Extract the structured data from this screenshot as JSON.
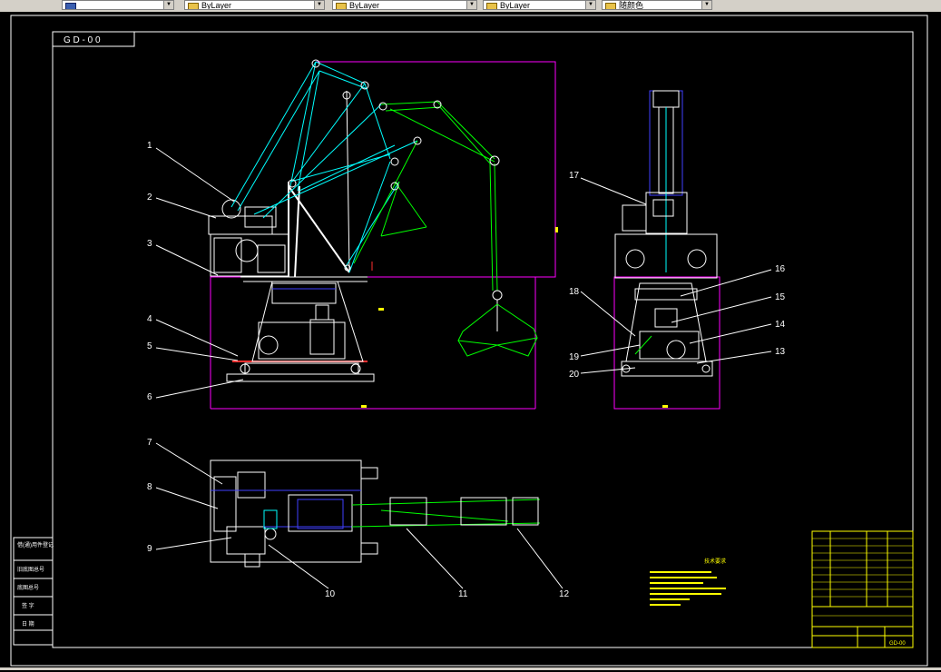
{
  "toolbar": {
    "items": [
      {
        "label": "",
        "swatch": "blue"
      },
      {
        "label": "ByLayer",
        "swatch": "yellow"
      },
      {
        "label": "ByLayer",
        "swatch": "yellow"
      },
      {
        "label": "ByLayer",
        "swatch": "yellow"
      },
      {
        "label": "随颜色",
        "swatch": "yellow"
      }
    ]
  },
  "drawing": {
    "code": "G D - 0 0",
    "callouts_front": [
      "1",
      "2",
      "3",
      "4",
      "5",
      "6"
    ],
    "callouts_side": [
      "17",
      "16",
      "15",
      "14",
      "13",
      "18",
      "19",
      "20"
    ],
    "callouts_top": [
      "7",
      "8",
      "9",
      "10",
      "11",
      "12"
    ],
    "tech_title": "技术要求",
    "left_stamp": [
      "借(通)用件登记",
      "旧底图总号",
      "底图总号",
      "签 字",
      "日 期"
    ],
    "titleblock_code": "GD-00"
  },
  "colors": {
    "frame": "#ffffff",
    "cyan": "#00ffff",
    "green": "#00ff00",
    "yellow": "#ffff00",
    "magenta": "#ff00ff",
    "blue": "#4040ff",
    "red": "#ff3030"
  }
}
